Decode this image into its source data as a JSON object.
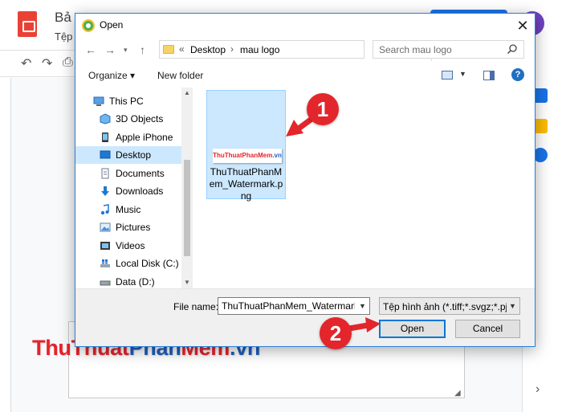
{
  "background_app": {
    "title": "Bả",
    "menu_partial": "Tệp"
  },
  "watermark": {
    "part1": "Thu",
    "part2": "Thuat",
    "part3": "Phan",
    "part4": "Mem",
    "part5": ".vn"
  },
  "dialog": {
    "title": "Open",
    "close_label": "✕",
    "address": {
      "prefix": "«",
      "segments": [
        "Desktop",
        "mau logo"
      ],
      "separator": "›"
    },
    "search": {
      "placeholder": "Search mau logo"
    },
    "commands": {
      "organize": "Organize ▾",
      "new_folder": "New folder"
    },
    "nav_items": [
      {
        "label": "This PC",
        "icon": "computer-icon",
        "root": true
      },
      {
        "label": "3D Objects",
        "icon": "cube-icon"
      },
      {
        "label": "Apple iPhone",
        "icon": "phone-icon"
      },
      {
        "label": "Desktop",
        "icon": "desktop-icon",
        "selected": true
      },
      {
        "label": "Documents",
        "icon": "document-icon"
      },
      {
        "label": "Downloads",
        "icon": "download-icon"
      },
      {
        "label": "Music",
        "icon": "music-icon"
      },
      {
        "label": "Pictures",
        "icon": "pictures-icon"
      },
      {
        "label": "Videos",
        "icon": "videos-icon"
      },
      {
        "label": "Local Disk (C:)",
        "icon": "drive-icon"
      },
      {
        "label": "Data (D:)",
        "icon": "drive-icon"
      }
    ],
    "file": {
      "name": "ThuThuatPhanMem_Watermark.png",
      "thumb_part1": "ThuThuatPhanMem",
      "thumb_part2": ".vn"
    },
    "bottom": {
      "file_name_label": "File name:",
      "file_name_value": "ThuThuatPhanMem_Watermark.p",
      "file_type": "Tệp hình ảnh (*.tiff;*.svgz;*.pjp;",
      "open_label": "Open",
      "cancel_label": "Cancel"
    }
  },
  "annotations": {
    "step1": "1",
    "step2": "2"
  },
  "colors": {
    "accent": "#0078d7",
    "selection": "#cce8ff",
    "badge_red": "#e2262b",
    "watermark_red": "#e8222b",
    "watermark_blue": "#1d5fbf"
  }
}
